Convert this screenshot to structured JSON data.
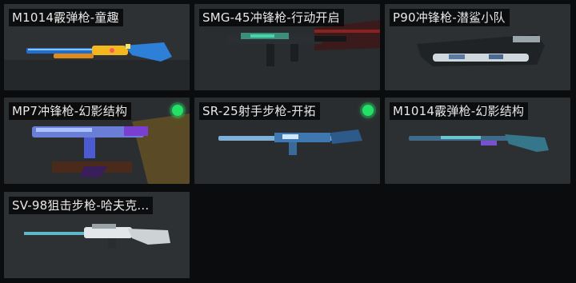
{
  "weapons": [
    {
      "name": "M1014霰弹枪-童趣",
      "equipped": false
    },
    {
      "name": "SMG-45冲锋枪-行动开启",
      "equipped": false
    },
    {
      "name": "P90冲锋枪-潜鲨小队",
      "equipped": false
    },
    {
      "name": "MP7冲锋枪-幻影结构",
      "equipped": true
    },
    {
      "name": "SR-25射手步枪-开拓",
      "equipped": true
    },
    {
      "name": "M1014霰弹枪-幻影结构",
      "equipped": false
    },
    {
      "name": "SV-98狙击步枪-哈夫克...",
      "equipped": false
    }
  ],
  "colors": {
    "equipped_indicator": "#23e066"
  }
}
